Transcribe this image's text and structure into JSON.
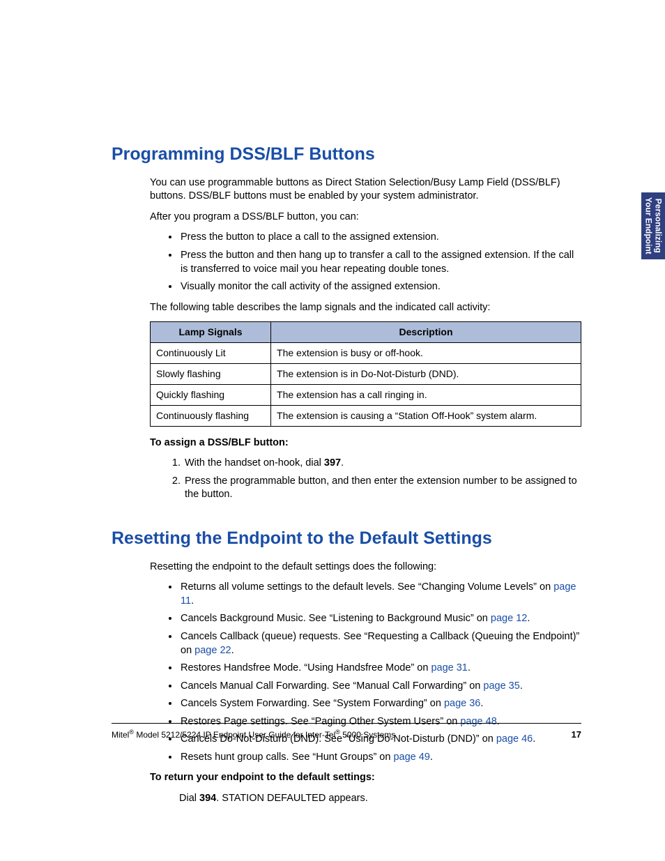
{
  "sidetab": {
    "line1": "Personalizing",
    "line2": "Your Endpoint"
  },
  "sec1": {
    "title": "Programming DSS/BLF Buttons",
    "p1": "You can use programmable buttons as Direct Station Selection/Busy Lamp Field (DSS/BLF) buttons. DSS/BLF buttons must be enabled by your system administrator.",
    "p2": "After you program a DSS/BLF button, you can:",
    "bullets": [
      "Press the button to place a call to the assigned extension.",
      "Press the button and then hang up to transfer a call to the assigned extension. If the call is transferred to voice mail you hear repeating double tones.",
      "Visually monitor the call activity of the assigned extension."
    ],
    "p3": "The following table describes the lamp signals and the indicated call activity:",
    "table": {
      "headers": [
        "Lamp Signals",
        "Description"
      ],
      "rows": [
        [
          "Continuously Lit",
          "The extension is busy or off-hook."
        ],
        [
          "Slowly flashing",
          "The extension is in Do-Not-Disturb (DND)."
        ],
        [
          "Quickly flashing",
          "The extension has a call ringing in."
        ],
        [
          "Continuously flashing",
          "The extension is causing a “Station Off-Hook” system alarm."
        ]
      ]
    },
    "assign_heading": "To assign a DSS/BLF button:",
    "steps": {
      "s1_pre": "With the handset on-hook, dial ",
      "s1_code": "397",
      "s1_post": ".",
      "s2": "Press the programmable button, and then enter the extension number to be assigned to the button."
    }
  },
  "sec2": {
    "title": "Resetting the Endpoint to the Default Settings",
    "p1": "Resetting the endpoint to the default settings does the following:",
    "items": [
      {
        "pre": "Returns all volume settings to the default levels. See “Changing Volume Levels” on ",
        "link": "page 11",
        "post": "."
      },
      {
        "pre": "Cancels Background Music. See “Listening to Background Music” on ",
        "link": "page 12",
        "post": "."
      },
      {
        "pre": "Cancels Callback (queue) requests. See “Requesting a Callback (Queuing the Endpoint)” on ",
        "link": "page 22",
        "post": "."
      },
      {
        "pre": "Restores Handsfree Mode. “Using Handsfree Mode” on ",
        "link": "page 31",
        "post": "."
      },
      {
        "pre": "Cancels Manual Call Forwarding. See “Manual Call Forwarding” on ",
        "link": "page 35",
        "post": "."
      },
      {
        "pre": "Cancels System Forwarding. See “System Forwarding” on ",
        "link": "page 36",
        "post": "."
      },
      {
        "pre": "Restores Page settings. See “Paging Other System Users” on ",
        "link": "page 48",
        "post": "."
      },
      {
        "pre": "Cancels Do-Not-Disturb (DND). See “Using Do-Not-Disturb (DND)” on ",
        "link": "page 46",
        "post": "."
      },
      {
        "pre": "Resets hunt group calls. See “Hunt Groups” on ",
        "link": "page 49",
        "post": "."
      }
    ],
    "return_heading": "To return your endpoint to the default settings:",
    "action_pre": "Dial ",
    "action_code": "394",
    "action_post": ". STATION DEFAULTED appears."
  },
  "footer": {
    "text_parts": [
      "Mitel",
      "®",
      " Model 5212/5224 IP Endpoint User Guide for Inter-Tel",
      "®",
      " 5000 Systems"
    ],
    "page": "17"
  }
}
